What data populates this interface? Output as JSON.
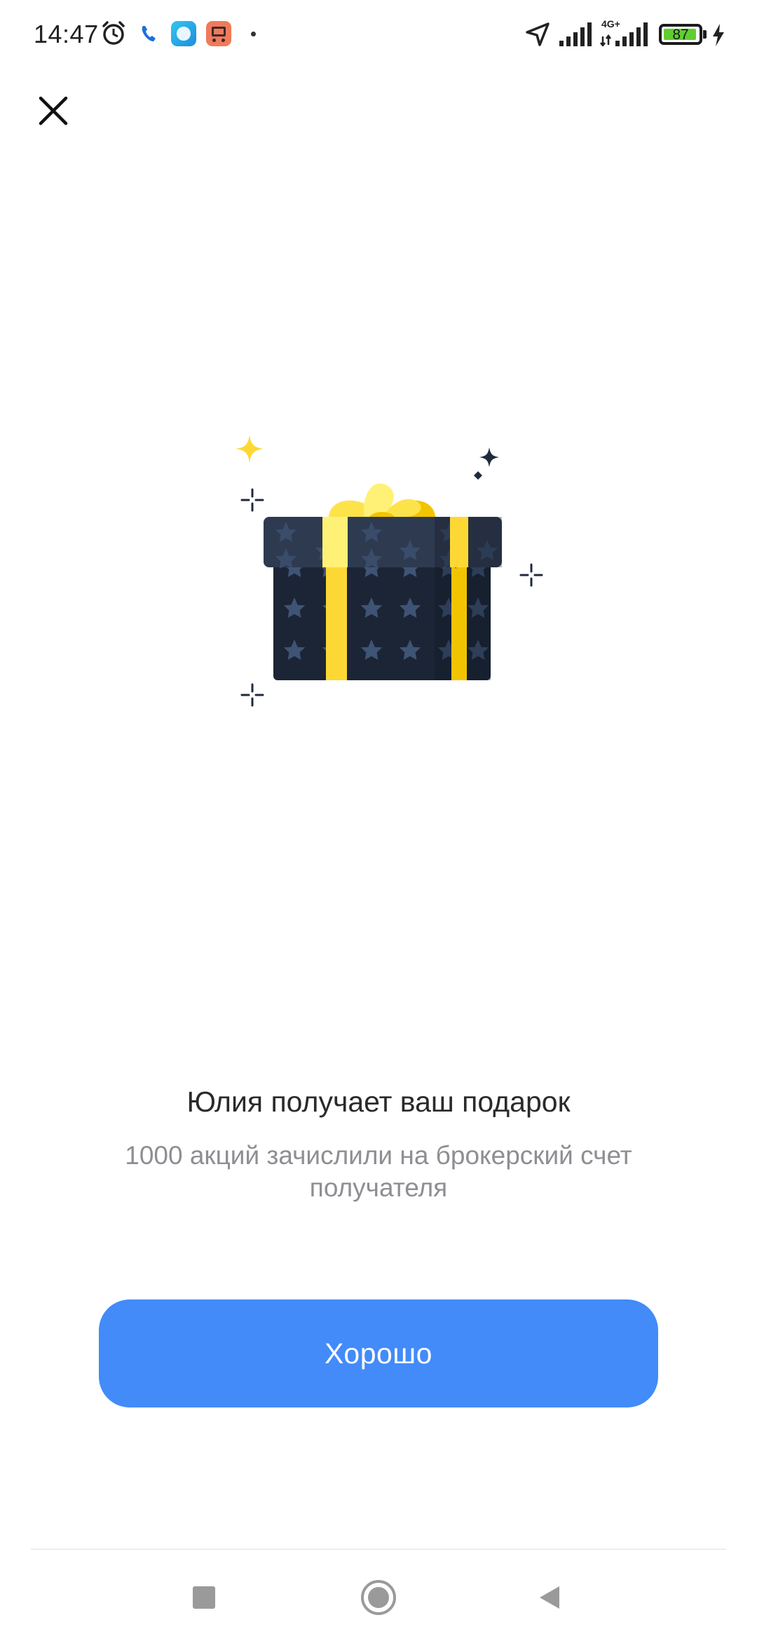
{
  "status_bar": {
    "time": "14:47",
    "network_type": "4G+",
    "battery_percent": "87",
    "battery_level": 0.87,
    "icons": [
      "alarm-icon",
      "phone-icon",
      "app-notification-icon",
      "app-notification-icon",
      "dot-icon",
      "location-arrow-icon",
      "signal-icon",
      "signal-4g-icon",
      "battery-icon",
      "charging-icon"
    ]
  },
  "dialog": {
    "close_icon": "close-icon",
    "title": "Юлия получает ваш подарок",
    "subtitle": "1000 акций зачислили на брокерский счет получателя",
    "ok_label": "Хорошо"
  },
  "navigation_bar": {
    "icons": [
      "recents-square-icon",
      "home-circle-icon",
      "back-triangle-icon"
    ]
  },
  "colors": {
    "accent": "#428bf9",
    "gift_box": "#1f2a3d",
    "ribbon": "#fdd835",
    "subtitle": "#8e8e93"
  }
}
